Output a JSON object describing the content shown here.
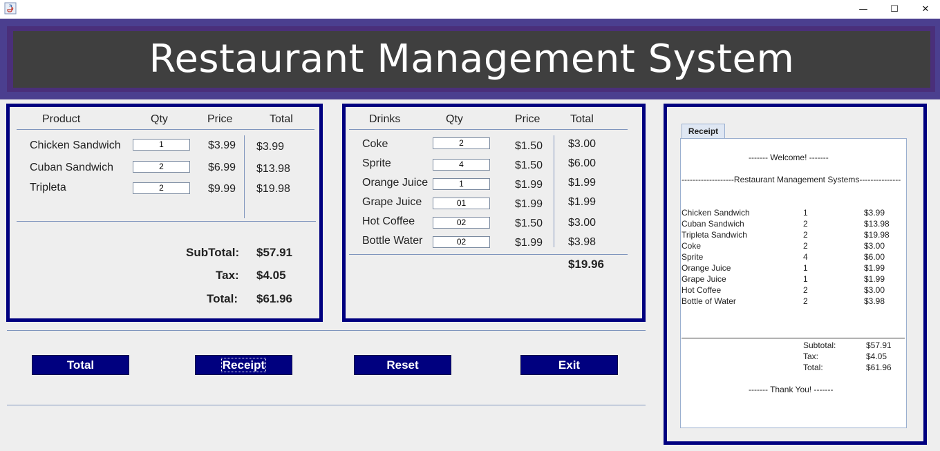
{
  "window": {
    "minimize_glyph": "—",
    "maximize_glyph": "☐",
    "close_glyph": "✕",
    "icon": "java-icon"
  },
  "header": {
    "title": "Restaurant Management System"
  },
  "food": {
    "headers": {
      "product": "Product",
      "qty": "Qty",
      "price": "Price",
      "total": "Total"
    },
    "items": [
      {
        "name": "Chicken Sandwich",
        "qty": "1",
        "price": "$3.99",
        "total": "$3.99"
      },
      {
        "name": "Cuban Sandwich",
        "qty": "2",
        "price": "$6.99",
        "total": "$13.98"
      },
      {
        "name": "Tripleta",
        "qty": "2",
        "price": "$9.99",
        "total": "$19.98"
      }
    ],
    "subtotal_label": "SubTotal:",
    "subtotal_value": "$57.91",
    "tax_label": "Tax:",
    "tax_value": "$4.05",
    "total_label": "Total:",
    "total_value": "$61.96"
  },
  "drinks": {
    "headers": {
      "product": "Drinks",
      "qty": "Qty",
      "price": "Price",
      "total": "Total"
    },
    "items": [
      {
        "name": "Coke",
        "qty": "2",
        "price": "$1.50",
        "total": "$3.00"
      },
      {
        "name": "Sprite",
        "qty": "4",
        "price": "$1.50",
        "total": "$6.00"
      },
      {
        "name": "Orange Juice",
        "qty": "1",
        "price": "$1.99",
        "total": "$1.99"
      },
      {
        "name": "Grape Juice",
        "qty": "01",
        "price": "$1.99",
        "total": "$1.99"
      },
      {
        "name": "Hot Coffee",
        "qty": "02",
        "price": "$1.50",
        "total": "$3.00"
      },
      {
        "name": "Bottle Water",
        "qty": "02",
        "price": "$1.99",
        "total": "$3.98"
      }
    ],
    "grand_total": "$19.96"
  },
  "buttons": {
    "total": "Total",
    "receipt": "Receipt",
    "reset": "Reset",
    "exit": "Exit"
  },
  "receipt": {
    "tab_label": "Receipt",
    "welcome": "-------   Welcome!  -------",
    "banner": "-------------------Restaurant Management Systems---------------",
    "lines": [
      {
        "name": "Chicken Sandwich",
        "qty": "1",
        "price": "$3.99"
      },
      {
        "name": "Cuban Sandwich",
        "qty": "2",
        "price": "$13.98"
      },
      {
        "name": "Tripleta Sandwich",
        "qty": "2",
        "price": "$19.98"
      },
      {
        "name": "Coke",
        "qty": "2",
        "price": "$3.00"
      },
      {
        "name": "Sprite",
        "qty": "4",
        "price": "$6.00"
      },
      {
        "name": "Orange Juice",
        "qty": "1",
        "price": "$1.99"
      },
      {
        "name": "Grape Juice",
        "qty": "1",
        "price": "$1.99"
      },
      {
        "name": "Hot Coffee",
        "qty": "2",
        "price": "$3.00"
      },
      {
        "name": "Bottle of Water",
        "qty": "2",
        "price": "$3.98"
      }
    ],
    "subtotal_label": "Subtotal:",
    "subtotal_value": "$57.91",
    "tax_label": "Tax:",
    "tax_value": "$4.05",
    "total_label": "Total:",
    "total_value": "$61.96",
    "thanks": "-------   Thank You!  -------"
  },
  "colors": {
    "accent": "#00007f",
    "banner": "#3f3f3f",
    "banner_frame": "#4b3f8f"
  }
}
